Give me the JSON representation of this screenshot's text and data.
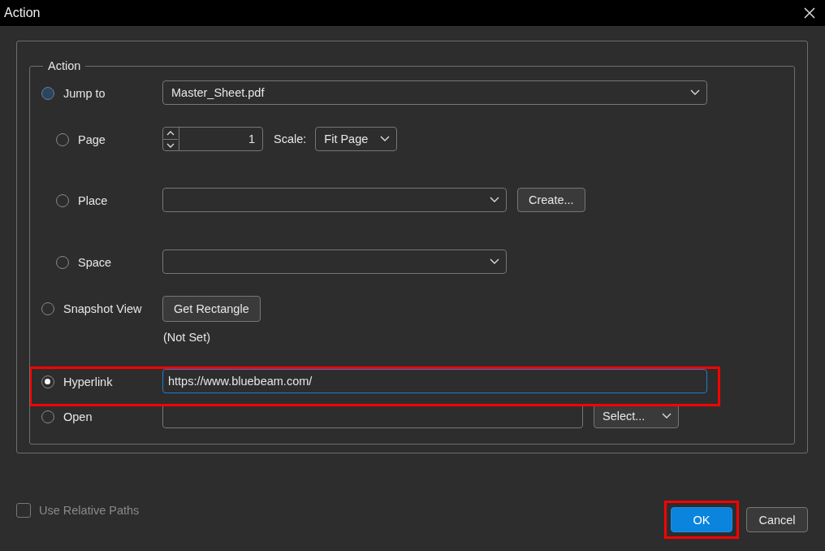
{
  "window": {
    "title": "Action"
  },
  "group": {
    "legend": "Action"
  },
  "options": [
    {
      "kind": "file",
      "label": "Jump to",
      "selected": false,
      "shaded": true,
      "indented": false,
      "highlighted": false,
      "value": "Master_Sheet.pdf"
    },
    {
      "kind": "page",
      "label": "Page",
      "selected": false,
      "shaded": false,
      "indented": true,
      "highlighted": false,
      "value": "1",
      "scale_label": "Scale:",
      "scale": "Fit Page"
    },
    {
      "kind": "place",
      "label": "Place",
      "selected": false,
      "shaded": false,
      "indented": true,
      "highlighted": false,
      "button": "Create..."
    },
    {
      "kind": "space",
      "label": "Space",
      "selected": false,
      "shaded": false,
      "indented": true,
      "highlighted": false
    },
    {
      "kind": "snapshot",
      "label": "Snapshot View",
      "selected": false,
      "shaded": false,
      "indented": false,
      "highlighted": false,
      "button": "Get Rectangle",
      "note": "(Not Set)"
    },
    {
      "kind": "hyperlink",
      "label": "Hyperlink",
      "selected": true,
      "shaded": false,
      "indented": false,
      "highlighted": true,
      "value": "https://www.bluebeam.com/"
    },
    {
      "kind": "open",
      "label": "Open",
      "selected": false,
      "shaded": false,
      "indented": false,
      "highlighted": false,
      "button": "Select..."
    }
  ],
  "use_relative_paths": {
    "label": "Use Relative Paths",
    "checked": false,
    "disabled": true
  },
  "buttons": [
    {
      "label": "OK",
      "primary": true,
      "highlighted": true
    },
    {
      "label": "Cancel",
      "primary": false,
      "highlighted": false
    }
  ]
}
